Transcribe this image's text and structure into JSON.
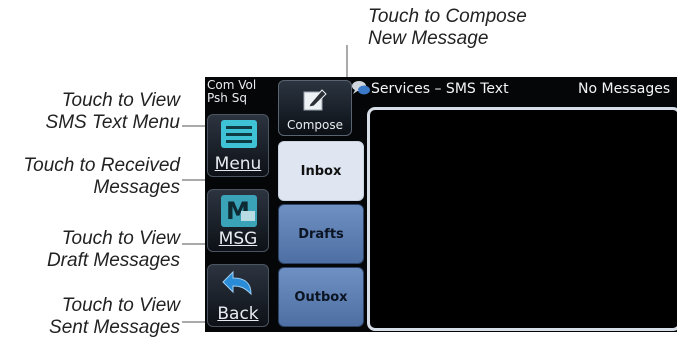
{
  "callouts": {
    "compose": [
      "Touch to Compose",
      "New Message"
    ],
    "sms_menu": [
      "Touch to View",
      "SMS Text Menu"
    ],
    "received": [
      "Touch to Received",
      "Messages"
    ],
    "drafts": [
      "Touch to View",
      "Draft Messages"
    ],
    "sent": [
      "Touch to View",
      "Sent Messages"
    ]
  },
  "screen": {
    "status_lines": [
      "Com Vol",
      "Psh Sq"
    ],
    "title": "Services – SMS Text",
    "message_status": "No Messages",
    "compose_label": "Compose",
    "menu_label": "Menu",
    "msg_label": "MSG",
    "back_label": "Back",
    "tabs": [
      "Inbox",
      "Drafts",
      "Outbox"
    ],
    "active_tab": "Inbox"
  },
  "colors": {
    "tab_active": "#dfe6f1",
    "tab_inactive": "#6f90c2",
    "menu_icon": "#3fc1d6",
    "back_icon": "#2a8bd6"
  }
}
